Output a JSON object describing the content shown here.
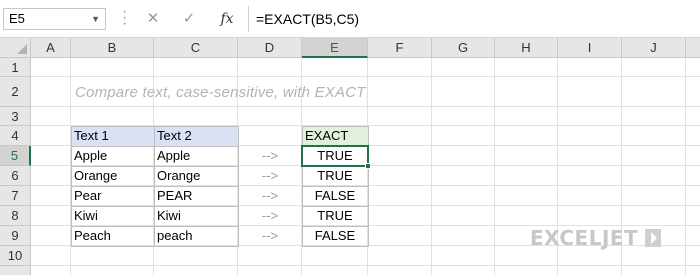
{
  "formula_bar": {
    "name_box": "E5",
    "cancel_icon": "✕",
    "enter_icon": "✓",
    "fx_label": "fx",
    "formula": "=EXACT(B5,C5)"
  },
  "sheet": {
    "columns": [
      "A",
      "B",
      "C",
      "D",
      "E",
      "F",
      "G",
      "H",
      "I",
      "J"
    ],
    "rows": [
      "1",
      "2",
      "3",
      "4",
      "5",
      "6",
      "7",
      "8",
      "9",
      "10"
    ],
    "active_cell": "E5",
    "title": "Compare text, case-sensitive, with EXACT",
    "table": {
      "headers": [
        "Text 1",
        "Text 2"
      ],
      "result_header": "EXACT",
      "rows": [
        {
          "text1": "Apple",
          "text2": "Apple",
          "arrow": "-->",
          "result": "TRUE"
        },
        {
          "text1": "Orange",
          "text2": "Orange",
          "arrow": "-->",
          "result": "TRUE"
        },
        {
          "text1": "Pear",
          "text2": "PEAR",
          "arrow": "-->",
          "result": "FALSE"
        },
        {
          "text1": "Kiwi",
          "text2": "Kiwi",
          "arrow": "-->",
          "result": "TRUE"
        },
        {
          "text1": "Peach",
          "text2": "peach",
          "arrow": "-->",
          "result": "FALSE"
        }
      ]
    },
    "header_fill_color": "#d9e1f2",
    "result_header_fill_color": "#e2efda",
    "selection_color": "#217346"
  },
  "logo": {
    "text": "EXCELJET"
  }
}
